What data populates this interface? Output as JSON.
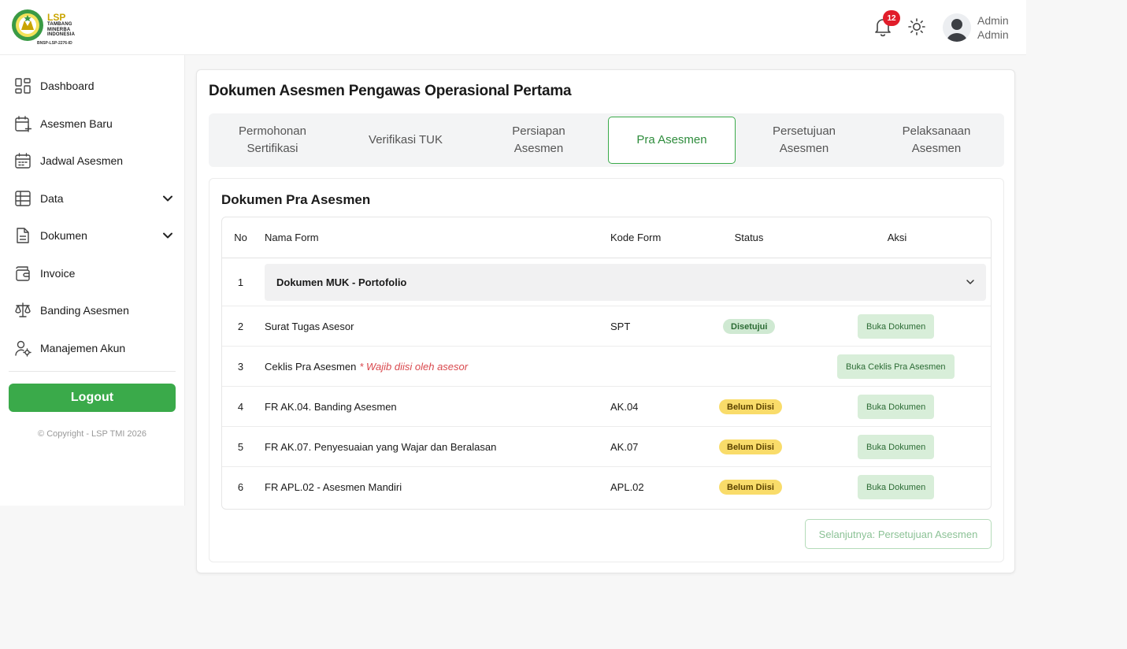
{
  "brand": {
    "logo_title": "LSP",
    "logo_lines": [
      "TAMBANG",
      "MINERBA",
      "INDONESIA"
    ],
    "logo_code": "BNSP-LSP-2276-ID",
    "accent_color": "#3aaa4a"
  },
  "header": {
    "notification_count": "12",
    "user_first": "Admin",
    "user_last": "Admin"
  },
  "sidebar": {
    "items": [
      {
        "label": "Dashboard",
        "icon": "dashboard-icon"
      },
      {
        "label": "Asesmen Baru",
        "icon": "calendar-plus-icon"
      },
      {
        "label": "Jadwal Asesmen",
        "icon": "calendar-icon"
      },
      {
        "label": "Data",
        "icon": "table-icon",
        "expandable": true
      },
      {
        "label": "Dokumen",
        "icon": "document-icon",
        "expandable": true
      },
      {
        "label": "Invoice",
        "icon": "wallet-icon"
      },
      {
        "label": "Banding Asesmen",
        "icon": "scale-icon"
      },
      {
        "label": "Manajemen Akun",
        "icon": "user-gear-icon"
      }
    ],
    "logout_label": "Logout",
    "copyright": "© Copyright - LSP TMI 2026"
  },
  "main": {
    "title": "Dokumen Asesmen Pengawas Operasional Pertama",
    "tabs": [
      {
        "label": "Permohonan\nSertifikasi",
        "active": false
      },
      {
        "label": "Verifikasi TUK",
        "active": false
      },
      {
        "label": "Persiapan\nAsesmen",
        "active": false
      },
      {
        "label": "Pra Asesmen",
        "active": true
      },
      {
        "label": "Persetujuan\nAsesmen",
        "active": false
      },
      {
        "label": "Pelaksanaan\nAsesmen",
        "active": false
      }
    ],
    "section_title": "Dokumen Pra Asesmen",
    "table": {
      "headers": {
        "no": "No",
        "nama": "Nama Form",
        "kode": "Kode Form",
        "status": "Status",
        "aksi": "Aksi"
      },
      "rows": [
        {
          "no": "1",
          "nama": "Dokumen MUK - Portofolio",
          "accordion": true
        },
        {
          "no": "2",
          "nama": "Surat Tugas Asesor",
          "kode": "SPT",
          "status": "Disetujui",
          "action": "Buka Dokumen"
        },
        {
          "no": "3",
          "nama": "Ceklis Pra Asesmen",
          "note": "* Wajib diisi oleh asesor",
          "kode": "",
          "status": "",
          "action": "Buka Ceklis Pra Asesmen"
        },
        {
          "no": "4",
          "nama": "FR AK.04. Banding Asesmen",
          "kode": "AK.04",
          "status": "Belum Diisi",
          "action": "Buka Dokumen"
        },
        {
          "no": "5",
          "nama": "FR AK.07. Penyesuaian yang Wajar dan Beralasan",
          "kode": "AK.07",
          "status": "Belum Diisi",
          "action": "Buka Dokumen"
        },
        {
          "no": "6",
          "nama": "FR APL.02 - Asesmen Mandiri",
          "kode": "APL.02",
          "status": "Belum Diisi",
          "action": "Buka Dokumen"
        }
      ]
    },
    "next_label": "Selanjutnya: Persetujuan Asesmen"
  }
}
